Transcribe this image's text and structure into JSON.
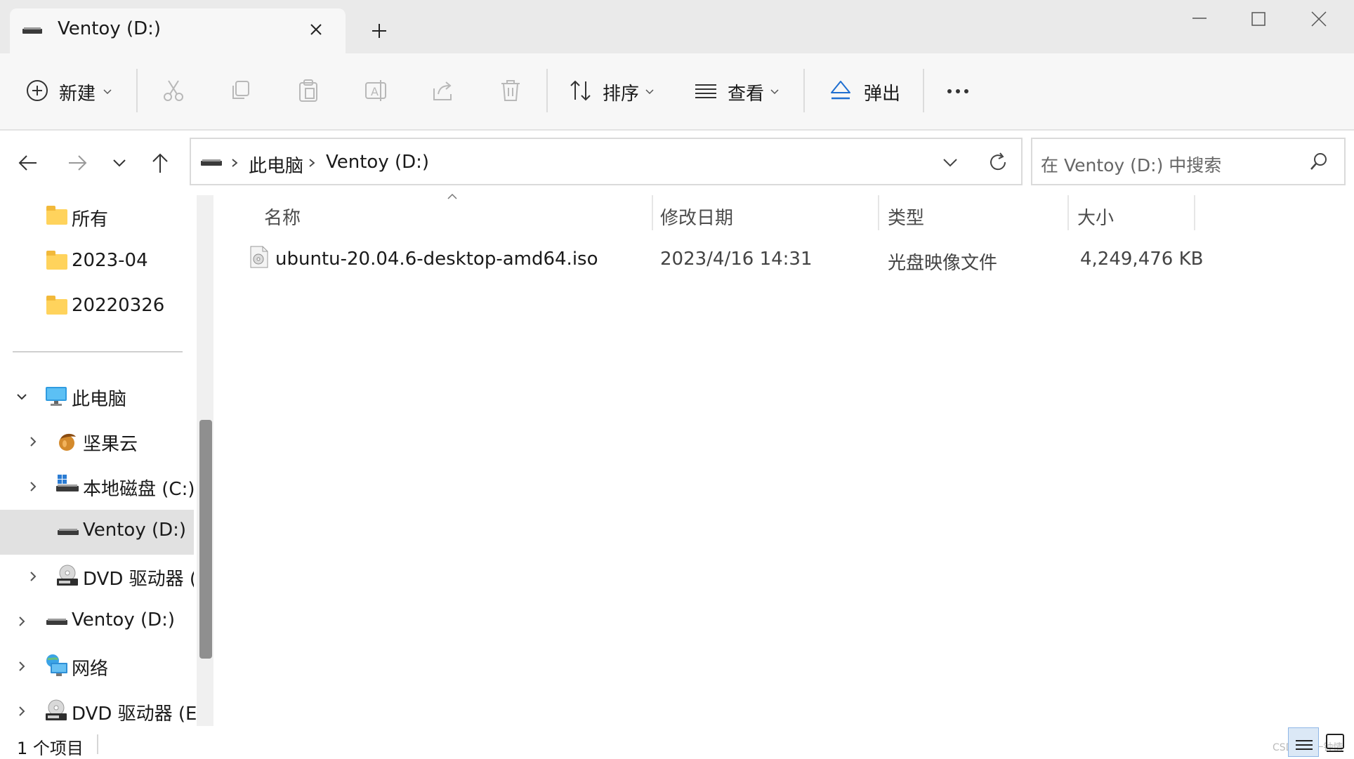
{
  "window": {
    "tab_title": "Ventoy (D:)"
  },
  "toolbar": {
    "new_label": "新建",
    "sort_label": "排序",
    "view_label": "查看",
    "eject_label": "弹出"
  },
  "address": {
    "crumbs": [
      "此电脑",
      "Ventoy (D:)"
    ],
    "search_placeholder": "在 Ventoy (D:) 中搜索"
  },
  "sidebar": {
    "pinned": [
      "所有",
      "2023-04",
      "20220326"
    ],
    "tree": [
      {
        "label": "此电脑",
        "icon": "monitor-icon"
      },
      {
        "label": "坚果云",
        "icon": "nut-icon"
      },
      {
        "label": "本地磁盘 (C:)",
        "icon": "windows-drive-icon"
      },
      {
        "label": "Ventoy (D:)",
        "icon": "usb-drive-icon"
      },
      {
        "label": "DVD 驱动器 (E",
        "icon": "dvd-drive-icon"
      },
      {
        "label": "Ventoy (D:)",
        "icon": "usb-drive-icon"
      },
      {
        "label": "网络",
        "icon": "network-icon"
      },
      {
        "label": "DVD 驱动器 (E:)",
        "icon": "dvd-drive-icon"
      }
    ]
  },
  "filelist": {
    "columns": [
      "名称",
      "修改日期",
      "类型",
      "大小"
    ],
    "rows": [
      {
        "name": "ubuntu-20.04.6-desktop-amd64.iso",
        "date": "2023/4/16 14:31",
        "type": "光盘映像文件",
        "size": "4,249,476 KB"
      }
    ]
  },
  "status": {
    "item_count": "1 个项目"
  },
  "watermark": "CSDN @一钟情"
}
